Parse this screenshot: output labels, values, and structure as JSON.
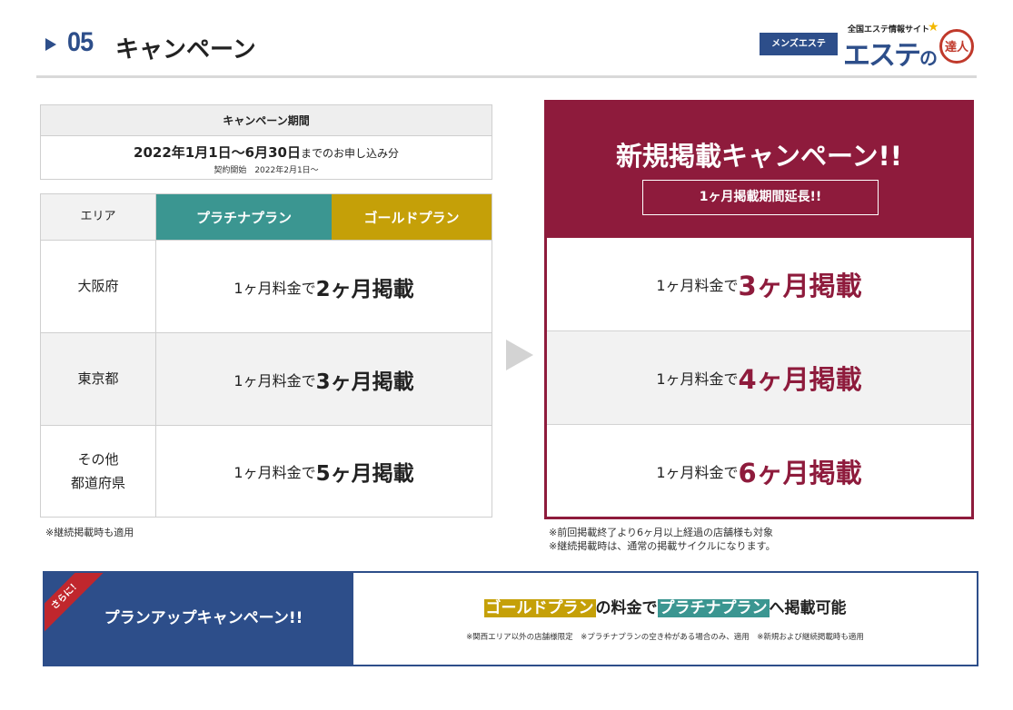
{
  "header": {
    "number": "05",
    "title": "キャンペーン",
    "badge": "メンズエステ",
    "logo_small": "全国エステ情報サイト",
    "logo_big": "エステ",
    "logo_no": "の",
    "logo_tatsujin": "達人"
  },
  "period": {
    "heading": "キャンペーン期間",
    "dates_bold": "2022年1月1日〜6月30日",
    "dates_suffix": "までのお申し込み分",
    "contract": "契約開始　2022年2月1日〜"
  },
  "table": {
    "col_area": "エリア",
    "col_platinum": "プラチナプラン",
    "col_gold": "ゴールドプラン",
    "rows": [
      {
        "area": "大阪府",
        "prefix": "1ヶ月料金で",
        "value": "2ヶ月掲載"
      },
      {
        "area": "東京都",
        "prefix": "1ヶ月料金で",
        "value": "3ヶ月掲載"
      },
      {
        "area": "その他\n都道府県",
        "prefix": "1ヶ月料金で",
        "value": "5ヶ月掲載"
      }
    ],
    "note": "※継続掲載時も適用"
  },
  "new_campaign": {
    "title": "新規掲載キャンペーン!!",
    "subtitle": "1ヶ月掲載期間延長!!",
    "rows": [
      {
        "prefix": "1ヶ月料金で",
        "value": "3ヶ月掲載"
      },
      {
        "prefix": "1ヶ月料金で",
        "value": "4ヶ月掲載"
      },
      {
        "prefix": "1ヶ月料金で",
        "value": "6ヶ月掲載"
      }
    ],
    "note1": "※前回掲載終了より6ヶ月以上経過の店舗様も対象",
    "note2": "※継続掲載時は、通常の掲載サイクルになります。"
  },
  "banner": {
    "ribbon": "さらに！",
    "title": "プランアップキャンペーン!!",
    "gold": "ゴールドプラン",
    "mid": "の料金で",
    "platinum": "プラチナプラン",
    "end": "へ掲載可能",
    "note": "※関西エリア以外の店舗様限定　※プラチナプランの空き枠がある場合のみ、適用　※新規および継続掲載時も適用"
  },
  "colors": {
    "navy": "#2d4e8a",
    "platinum": "#3b9691",
    "gold": "#c5a008",
    "wine": "#8e1b3c"
  }
}
